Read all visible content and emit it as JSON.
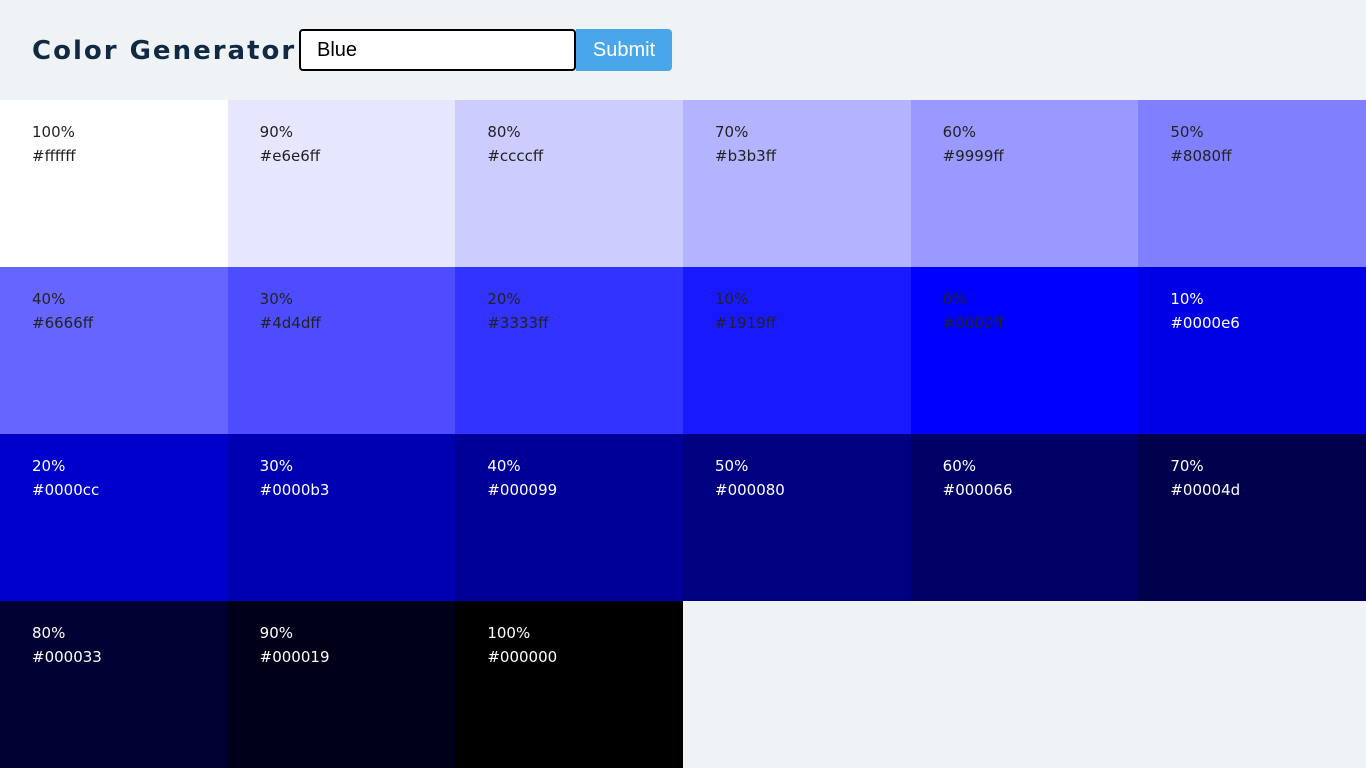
{
  "header": {
    "title": "Color Generator",
    "input_value": "Blue",
    "submit_label": "Submit"
  },
  "colors": [
    {
      "percent": "100%",
      "hex": "#ffffff",
      "bg": "#ffffff",
      "text": "dark"
    },
    {
      "percent": "90%",
      "hex": "#e6e6ff",
      "bg": "#e6e6ff",
      "text": "dark"
    },
    {
      "percent": "80%",
      "hex": "#ccccff",
      "bg": "#ccccff",
      "text": "dark"
    },
    {
      "percent": "70%",
      "hex": "#b3b3ff",
      "bg": "#b3b3ff",
      "text": "dark"
    },
    {
      "percent": "60%",
      "hex": "#9999ff",
      "bg": "#9999ff",
      "text": "dark"
    },
    {
      "percent": "50%",
      "hex": "#8080ff",
      "bg": "#8080ff",
      "text": "dark"
    },
    {
      "percent": "40%",
      "hex": "#6666ff",
      "bg": "#6666ff",
      "text": "dark"
    },
    {
      "percent": "30%",
      "hex": "#4d4dff",
      "bg": "#4d4dff",
      "text": "dark"
    },
    {
      "percent": "20%",
      "hex": "#3333ff",
      "bg": "#3333ff",
      "text": "dark"
    },
    {
      "percent": "10%",
      "hex": "#1919ff",
      "bg": "#1919ff",
      "text": "dark"
    },
    {
      "percent": "0%",
      "hex": "#0000ff",
      "bg": "#0000ff",
      "text": "dark"
    },
    {
      "percent": "10%",
      "hex": "#0000e6",
      "bg": "#0000e6",
      "text": "light"
    },
    {
      "percent": "20%",
      "hex": "#0000cc",
      "bg": "#0000cc",
      "text": "light"
    },
    {
      "percent": "30%",
      "hex": "#0000b3",
      "bg": "#0000b3",
      "text": "light"
    },
    {
      "percent": "40%",
      "hex": "#000099",
      "bg": "#000099",
      "text": "light"
    },
    {
      "percent": "50%",
      "hex": "#000080",
      "bg": "#000080",
      "text": "light"
    },
    {
      "percent": "60%",
      "hex": "#000066",
      "bg": "#000066",
      "text": "light"
    },
    {
      "percent": "70%",
      "hex": "#00004d",
      "bg": "#00004d",
      "text": "light"
    },
    {
      "percent": "80%",
      "hex": "#000033",
      "bg": "#000033",
      "text": "light"
    },
    {
      "percent": "90%",
      "hex": "#000019",
      "bg": "#000019",
      "text": "light"
    },
    {
      "percent": "100%",
      "hex": "#000000",
      "bg": "#000000",
      "text": "light"
    }
  ]
}
